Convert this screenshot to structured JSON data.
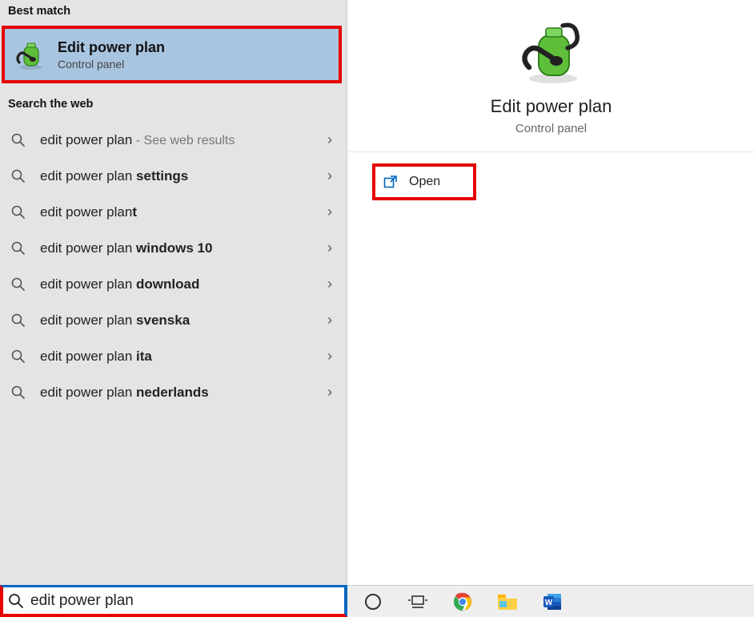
{
  "sections": {
    "best_match_header": "Best match",
    "search_web_header": "Search the web"
  },
  "best_match": {
    "title": "Edit power plan",
    "subtitle": "Control panel"
  },
  "web_results": [
    {
      "prefix": "edit power plan",
      "bold": "",
      "hint": " - See web results"
    },
    {
      "prefix": "edit power plan ",
      "bold": "settings",
      "hint": ""
    },
    {
      "prefix": "edit power plan",
      "bold": "t",
      "hint": ""
    },
    {
      "prefix": "edit power plan ",
      "bold": "windows 10",
      "hint": ""
    },
    {
      "prefix": "edit power plan ",
      "bold": "download",
      "hint": ""
    },
    {
      "prefix": "edit power plan ",
      "bold": "svenska",
      "hint": ""
    },
    {
      "prefix": "edit power plan ",
      "bold": "ita",
      "hint": ""
    },
    {
      "prefix": "edit power plan ",
      "bold": "nederlands",
      "hint": ""
    }
  ],
  "preview": {
    "title": "Edit power plan",
    "subtitle": "Control panel",
    "open_label": "Open"
  },
  "search": {
    "value": "edit power plan",
    "placeholder": ""
  },
  "taskbar": {
    "cortana": "cortana-icon",
    "taskview": "task-view-icon",
    "chrome": "chrome-icon",
    "explorer": "file-explorer-icon",
    "word": "word-icon"
  }
}
